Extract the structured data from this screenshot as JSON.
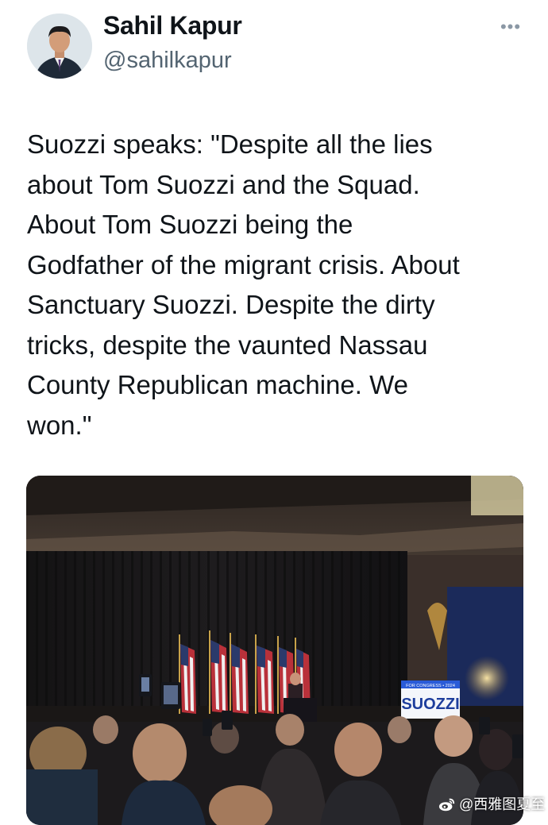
{
  "author": {
    "name": "Sahil Kapur",
    "handle": "@sahilkapur"
  },
  "tweet": {
    "text": "Suozzi speaks: \"Despite all the lies\nabout Tom Suozzi and the Squad.\nAbout Tom Suozzi being the\nGodfather of the migrant crisis. About\nSanctuary Suozzi. Despite the dirty\ntricks, despite the vaunted Nassau\nCounty Republican machine. We\nwon.\""
  },
  "media": {
    "sign_text": "SUOZZI",
    "sign_subtext": "FOR CONGRESS • 2024"
  },
  "watermark": {
    "text": "@西雅图夏至"
  },
  "icons": {
    "more": "more-options-icon",
    "weibo": "weibo-logo-icon"
  }
}
